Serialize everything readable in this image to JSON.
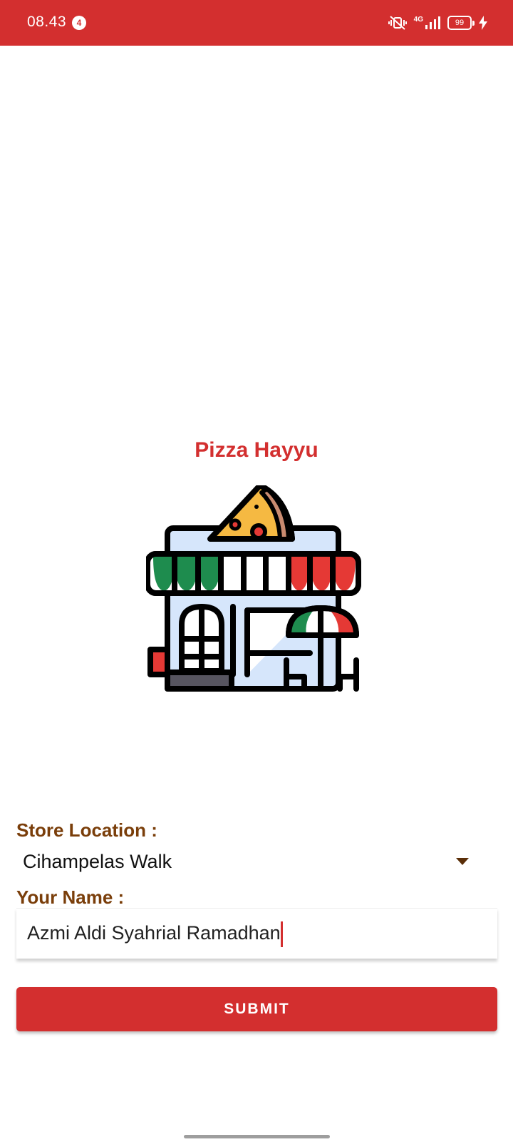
{
  "status_bar": {
    "time": "08.43",
    "notification_count": "4",
    "network": "4G",
    "battery": "99",
    "color": "#d32f2f"
  },
  "app": {
    "title": "Pizza Hayyu",
    "accent": "#d32f2f",
    "label_color": "#7a3e0a",
    "illustration": "pizza-store-icon"
  },
  "form": {
    "store_location_label": "Store Location :",
    "store_location_value": "Cihampelas Walk",
    "name_label": "Your Name :",
    "name_value": "Azmi Aldi Syahrial Ramadhan",
    "submit_label": "SUBMIT"
  }
}
